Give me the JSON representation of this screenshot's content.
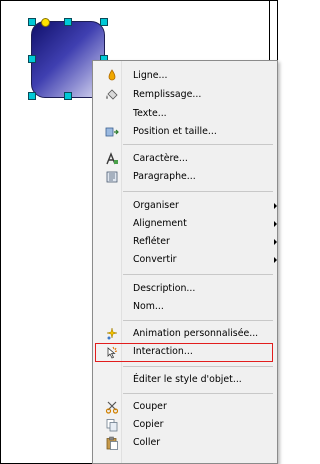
{
  "menu": {
    "items": [
      {
        "label": "Ligne...",
        "icon": "line-color-icon"
      },
      {
        "label": "Remplissage...",
        "icon": "paint-bucket-icon"
      },
      {
        "label": "Texte...",
        "icon": ""
      },
      {
        "label": "Position et taille...",
        "icon": "position-size-icon"
      },
      {
        "label": "Caractère...",
        "icon": "character-icon"
      },
      {
        "label": "Paragraphe...",
        "icon": "paragraph-icon"
      },
      {
        "label": "Organiser",
        "icon": ""
      },
      {
        "label": "Alignement",
        "icon": ""
      },
      {
        "label": "Refléter",
        "icon": ""
      },
      {
        "label": "Convertir",
        "icon": ""
      },
      {
        "label": "Description...",
        "icon": ""
      },
      {
        "label": "Nom...",
        "icon": ""
      },
      {
        "label": "Animation personnalisée...",
        "icon": "animation-icon"
      },
      {
        "label": "Interaction...",
        "icon": "interaction-icon",
        "highlighted": true
      },
      {
        "label": "Éditer le style d'objet...",
        "icon": ""
      },
      {
        "label": "Couper",
        "icon": "scissors-icon"
      },
      {
        "label": "Copier",
        "icon": "copy-icon"
      },
      {
        "label": "Coller",
        "icon": "paste-icon"
      }
    ]
  },
  "colors": {
    "highlight_border": "#e21d1d",
    "selection_handle": "#00c9d6",
    "rotation_handle": "#ffe400"
  }
}
